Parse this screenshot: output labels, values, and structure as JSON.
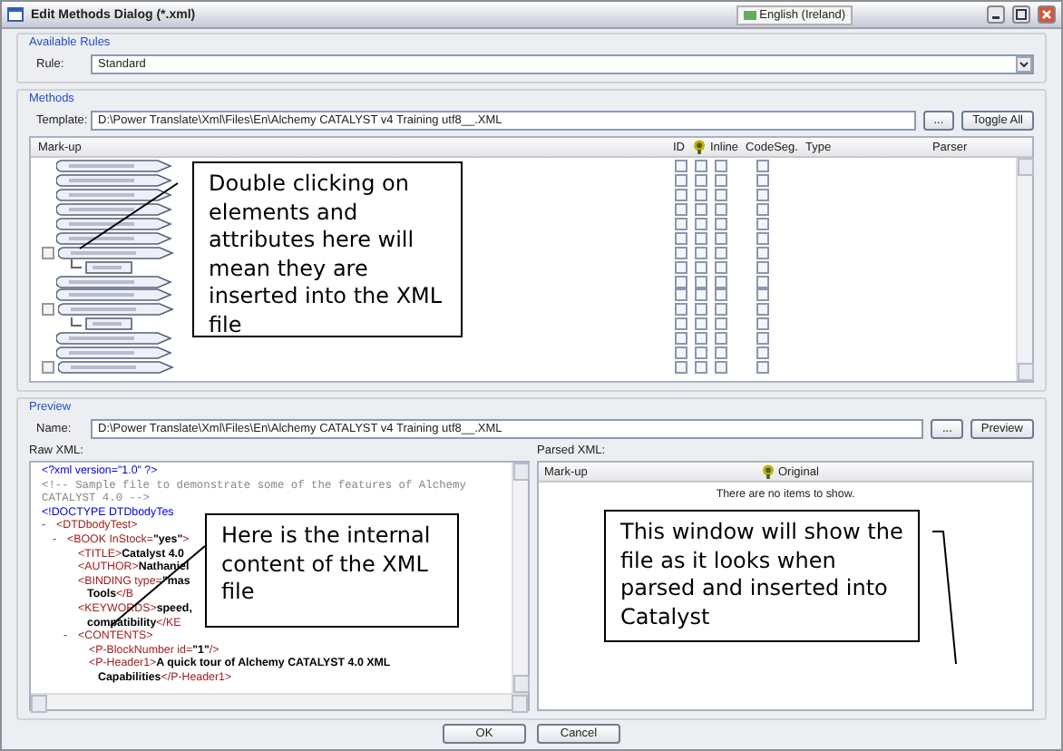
{
  "window": {
    "title": "Edit Methods Dialog (*.xml)",
    "language": "English (Ireland)"
  },
  "available_rules": {
    "heading": "Available Rules",
    "label": "Rule:",
    "value": "Standard"
  },
  "methods": {
    "heading": "Methods",
    "template_label": "Template:",
    "template_value": "D:\\Power Translate\\Xml\\Files\\En\\Alchemy CATALYST v4 Training utf8__.XML",
    "browse": "...",
    "toggle_all": "Toggle All",
    "columns": [
      {
        "kind": "markup",
        "label": "Mark-up"
      },
      {
        "kind": "check",
        "label": "ID"
      },
      {
        "kind": "icon"
      },
      {
        "kind": "check",
        "label": "Inline"
      },
      {
        "kind": "check",
        "label": "CodeSeg."
      },
      {
        "kind": "text",
        "label": "Type"
      },
      {
        "kind": "text",
        "label": "Parser"
      }
    ],
    "tree": [
      {
        "kind": "element",
        "id": false,
        "translate": false,
        "inline": false,
        "codeseg": false
      },
      {
        "kind": "element",
        "id": false,
        "translate": false,
        "inline": false,
        "codeseg": false
      },
      {
        "kind": "element",
        "id": false,
        "translate": false,
        "inline": false,
        "codeseg": false
      },
      {
        "kind": "element",
        "id": false,
        "translate": false,
        "inline": false,
        "codeseg": false
      },
      {
        "kind": "element",
        "id": false,
        "translate": false,
        "inline": false,
        "codeseg": false
      },
      {
        "kind": "element",
        "id": false,
        "translate": false,
        "inline": false,
        "codeseg": false
      },
      {
        "kind": "element",
        "expanded": true,
        "id": false,
        "translate": false,
        "inline": false,
        "codeseg": false,
        "children": [
          {
            "kind": "attribute",
            "id": false,
            "translate": false,
            "inline": false,
            "codeseg": false
          }
        ]
      },
      {
        "kind": "element",
        "id": false,
        "translate": false,
        "inline": false,
        "codeseg": false
      },
      {
        "kind": "element",
        "id": false,
        "translate": false,
        "inline": false,
        "codeseg": false
      },
      {
        "kind": "element",
        "expanded": true,
        "id": false,
        "translate": false,
        "inline": false,
        "codeseg": false,
        "children": [
          {
            "kind": "attribute",
            "id": false,
            "translate": false,
            "inline": false,
            "codeseg": false
          }
        ]
      },
      {
        "kind": "element",
        "id": false,
        "translate": false,
        "inline": false,
        "codeseg": false
      },
      {
        "kind": "element",
        "id": false,
        "translate": false,
        "inline": false,
        "codeseg": false
      },
      {
        "kind": "element",
        "expanded": true,
        "id": false,
        "translate": false,
        "inline": false,
        "codeseg": false
      }
    ]
  },
  "preview": {
    "heading": "Preview",
    "name_label": "Name:",
    "name_value": "D:\\Power Translate\\Xml\\Files\\En\\Alchemy CATALYST v4 Training utf8__.XML",
    "browse": "...",
    "preview_button": "Preview",
    "raw_label": "Raw XML:",
    "parsed_label": "Parsed XML:",
    "raw_xml": [
      {
        "kind": "line",
        "parts": [
          {
            "kind": "pi",
            "text": "<?xml version=\"1.0\" ?>"
          }
        ]
      },
      {
        "kind": "line",
        "parts": [
          {
            "kind": "comment",
            "text": "<!-- Sample file to demonstrate some of the features of Alchemy"
          }
        ]
      },
      {
        "kind": "line",
        "parts": [
          {
            "kind": "comment",
            "text": "CATALYST 4.0 -->"
          }
        ]
      },
      {
        "kind": "line",
        "parts": [
          {
            "kind": "pi",
            "text": "<!DOCTYPE DTDbodyTes"
          }
        ]
      },
      {
        "kind": "element",
        "toggle": "-",
        "parts": [
          {
            "kind": "tag",
            "text": "<DTDbodyTest>"
          }
        ],
        "children": [
          {
            "kind": "element",
            "toggle": "-",
            "parts": [
              {
                "kind": "tag",
                "text": "<BOOK InStock="
              },
              {
                "kind": "value",
                "text": "\"yes\""
              },
              {
                "kind": "tag",
                "text": ">"
              }
            ],
            "children": [
              {
                "kind": "line",
                "parts": [
                  {
                    "kind": "tag",
                    "text": "<TITLE>"
                  },
                  {
                    "kind": "value",
                    "text": "Catalyst 4.0"
                  }
                ]
              },
              {
                "kind": "line",
                "parts": [
                  {
                    "kind": "tag",
                    "text": "<AUTHOR>"
                  },
                  {
                    "kind": "value",
                    "text": "Nathaniel"
                  }
                ]
              },
              {
                "kind": "line",
                "parts": [
                  {
                    "kind": "tag",
                    "text": "<BINDING type="
                  },
                  {
                    "kind": "value",
                    "text": "\"mas"
                  }
                ]
              },
              {
                "kind": "continuation",
                "parts": [
                  {
                    "kind": "value",
                    "text": "Tools"
                  },
                  {
                    "kind": "tag",
                    "text": "</B"
                  }
                ]
              },
              {
                "kind": "line",
                "parts": [
                  {
                    "kind": "tag",
                    "text": "<KEYWORDS>"
                  },
                  {
                    "kind": "value",
                    "text": "speed,"
                  }
                ]
              },
              {
                "kind": "continuation",
                "parts": [
                  {
                    "kind": "value",
                    "text": "compatibility"
                  },
                  {
                    "kind": "tag",
                    "text": "</KE"
                  }
                ]
              },
              {
                "kind": "element",
                "toggle": "-",
                "parts": [
                  {
                    "kind": "tag",
                    "text": "<CONTENTS>"
                  }
                ],
                "children": [
                  {
                    "kind": "line",
                    "parts": [
                      {
                        "kind": "tag",
                        "text": "<P-BlockNumber id="
                      },
                      {
                        "kind": "value",
                        "text": "\"1\""
                      },
                      {
                        "kind": "tag",
                        "text": " />"
                      }
                    ]
                  },
                  {
                    "kind": "line",
                    "parts": [
                      {
                        "kind": "tag",
                        "text": "<P-Header1>"
                      },
                      {
                        "kind": "value",
                        "text": "A quick tour of Alchemy CATALYST 4.0 XML"
                      }
                    ]
                  },
                  {
                    "kind": "continuation",
                    "parts": [
                      {
                        "kind": "value",
                        "text": "Capabilities"
                      },
                      {
                        "kind": "tag",
                        "text": "</P-Header1>"
                      }
                    ]
                  }
                ]
              }
            ]
          }
        ]
      }
    ],
    "parsed_columns": [
      {
        "kind": "text",
        "label": "Mark-up"
      },
      {
        "kind": "icon",
        "label": "Original"
      }
    ],
    "empty_text": "There are no items to show."
  },
  "buttons": [
    "OK",
    "Cancel"
  ],
  "callouts": [
    {
      "text": "Double clicking on elements and attributes here will mean they are inserted into the XML file"
    },
    {
      "text": "Here is the internal content of the XML file"
    },
    {
      "text": "This window will show the file as it looks when parsed and inserted into Catalyst"
    }
  ]
}
